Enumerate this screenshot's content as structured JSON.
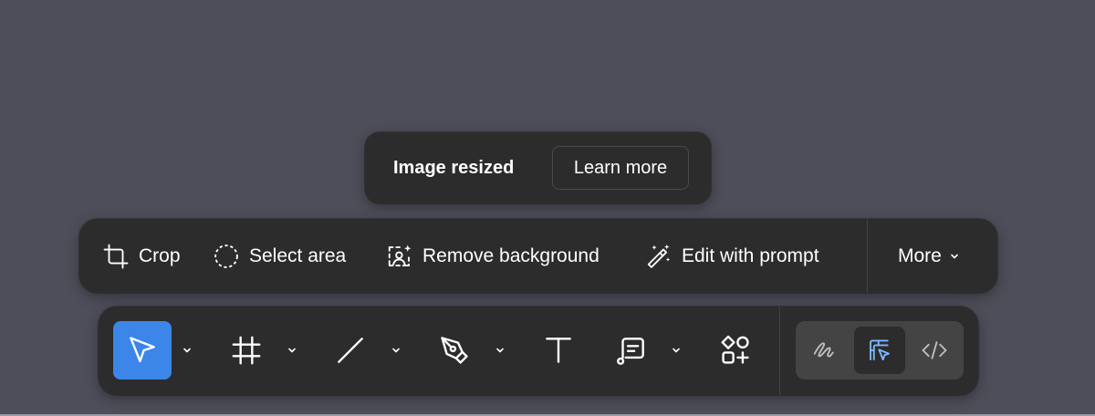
{
  "toast": {
    "message": "Image resized",
    "action_label": "Learn more"
  },
  "image_actions": {
    "items": [
      {
        "label": "Crop",
        "icon": "crop-icon"
      },
      {
        "label": "Select area",
        "icon": "lasso-select-icon"
      },
      {
        "label": "Remove background",
        "icon": "remove-background-icon"
      },
      {
        "label": "Edit with prompt",
        "icon": "magic-wand-icon"
      }
    ],
    "more_label": "More"
  },
  "toolbar": {
    "tools": [
      {
        "name": "Move",
        "icon": "cursor-arrow-icon",
        "active": true,
        "has_menu": true
      },
      {
        "name": "Frame",
        "icon": "frame-icon",
        "active": false,
        "has_menu": true
      },
      {
        "name": "Line",
        "icon": "line-icon",
        "active": false,
        "has_menu": true
      },
      {
        "name": "Pen",
        "icon": "pen-icon",
        "active": false,
        "has_menu": true
      },
      {
        "name": "Text",
        "icon": "text-icon",
        "active": false,
        "has_menu": false
      },
      {
        "name": "Comment",
        "icon": "comment-icon",
        "active": false,
        "has_menu": true
      },
      {
        "name": "Actions",
        "icon": "shapes-plus-icon",
        "active": false,
        "has_menu": false
      }
    ],
    "modes": [
      {
        "name": "Draw",
        "icon": "squiggle-icon",
        "active": false
      },
      {
        "name": "Design",
        "icon": "design-cursor-icon",
        "active": true
      },
      {
        "name": "Dev Mode",
        "icon": "code-brackets-icon",
        "active": false
      }
    ]
  },
  "colors": {
    "canvas": "#4e4e5a",
    "panel": "#2c2c2c",
    "accent": "#3b86e8",
    "icon_default": "#ffffff",
    "icon_muted": "#bfbfbf",
    "icon_active_mode": "#7cb8ff"
  }
}
